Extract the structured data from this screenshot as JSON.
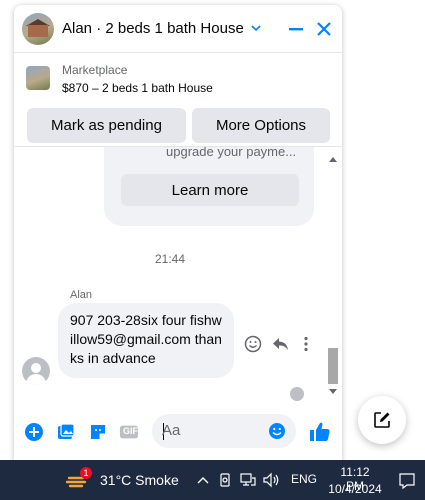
{
  "header": {
    "title": "Alan · 2 beds 1 bath House",
    "accent_color": "#0084ff",
    "icons": [
      "chevron-down-icon",
      "minimize-icon",
      "close-icon"
    ]
  },
  "marketplace": {
    "label": "Marketplace",
    "listing": "$870 – 2 beds 1 bath House",
    "mark_pending_label": "Mark as pending",
    "more_options_label": "More Options"
  },
  "messages": {
    "previous_card_text": "upgrade your payme...",
    "learn_more_label": "Learn more",
    "timestamp": "21:44",
    "sender_name": "Alan",
    "message_text": "907  203-28six four fishwillow59@gmail.com thanks in advance"
  },
  "composer": {
    "placeholder": "Aa",
    "icons": [
      "plus-icon",
      "photo-icon",
      "sticker-icon",
      "gif-icon",
      "emoji-icon",
      "like-icon"
    ],
    "gif_label": "GIF"
  },
  "taskbar": {
    "weather_badge": "1",
    "weather": "31°C  Smoke",
    "language": "ENG",
    "time": "11:12 PM",
    "date": "10/4/2024"
  }
}
